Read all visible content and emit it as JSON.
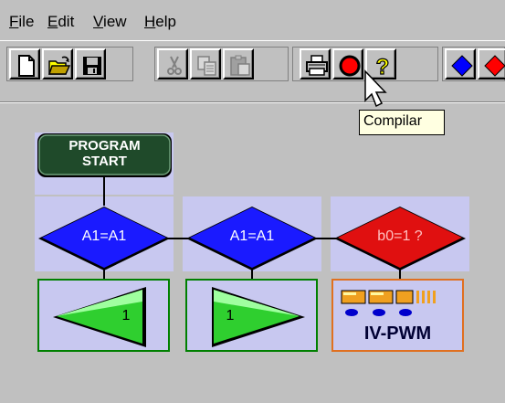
{
  "menu": {
    "items": [
      {
        "label": "File"
      },
      {
        "label": "Edit"
      },
      {
        "label": "View"
      },
      {
        "label": "Help"
      }
    ]
  },
  "toolbar": {
    "buttons": [
      "new-file",
      "open-folder",
      "save",
      "cut",
      "copy",
      "paste",
      "print",
      "compile",
      "help",
      "blue-diamond",
      "red-diamond"
    ]
  },
  "tooltip": {
    "text": "Compilar"
  },
  "program": {
    "start_line1": "PROGRAM",
    "start_line2": "START",
    "decisions": [
      {
        "label": "A1=A1",
        "color": "#1a1aff"
      },
      {
        "label": "A1=A1",
        "color": "#1a1aff"
      },
      {
        "label": "b0=1 ?",
        "color": "#e01010"
      }
    ],
    "actions": [
      {
        "value": "1",
        "direction": "left"
      },
      {
        "value": "1",
        "direction": "right"
      },
      {
        "label": "IV-PWM"
      }
    ]
  },
  "colors": {
    "window_bg": "#c0c0c0",
    "cell_bg": "#c8c8f0",
    "start_block": "#1f4a2a",
    "line": "#000000"
  }
}
